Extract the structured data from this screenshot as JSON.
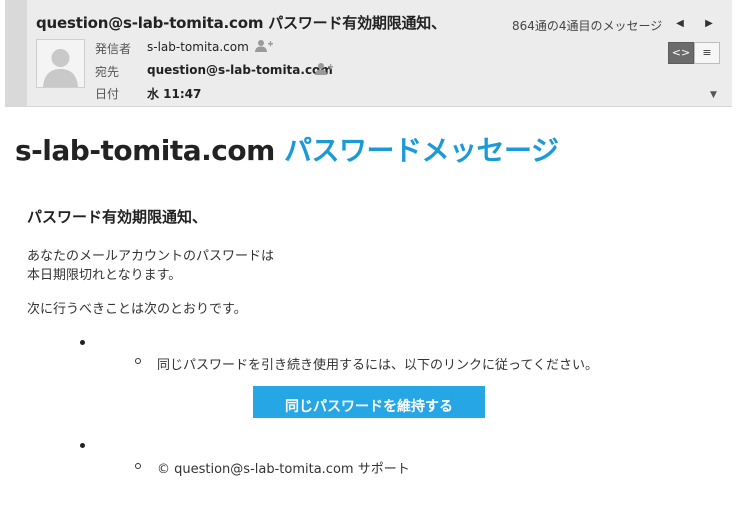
{
  "email": {
    "subject": "question@s-lab-tomita.com パスワード有効期限通知、",
    "counter": "864通の4通目のメッセージ",
    "from_label": "発信者",
    "from_value": "s-lab-tomita.com",
    "to_label": "宛先",
    "to_value": "question@s-lab-tomita.com",
    "date_label": "日付",
    "date_value": "水 11:47"
  },
  "icons": {
    "prev": "◀",
    "next": "▶",
    "html_view": "<>",
    "text_view": "≡",
    "dropdown": "▼"
  },
  "body": {
    "brand_domain": "s-lab-tomita.com",
    "brand_title": "パスワードメッセージ",
    "greeting": "パスワード有効期限通知、",
    "line1": "あなたのメールアカウントのパスワードは",
    "line2": "本日期限切れとなります。",
    "next_step": "次に行うべきことは次のとおりです。",
    "instruction": "同じパスワードを引き続き使用するには、以下のリンクに従ってください。",
    "button_label": "同じパスワードを維持する",
    "footer": "© question@s-lab-tomita.com サポート"
  },
  "colors": {
    "accent": "#1b9ad8",
    "button": "#27a6e6",
    "header_bg": "#ececec"
  }
}
